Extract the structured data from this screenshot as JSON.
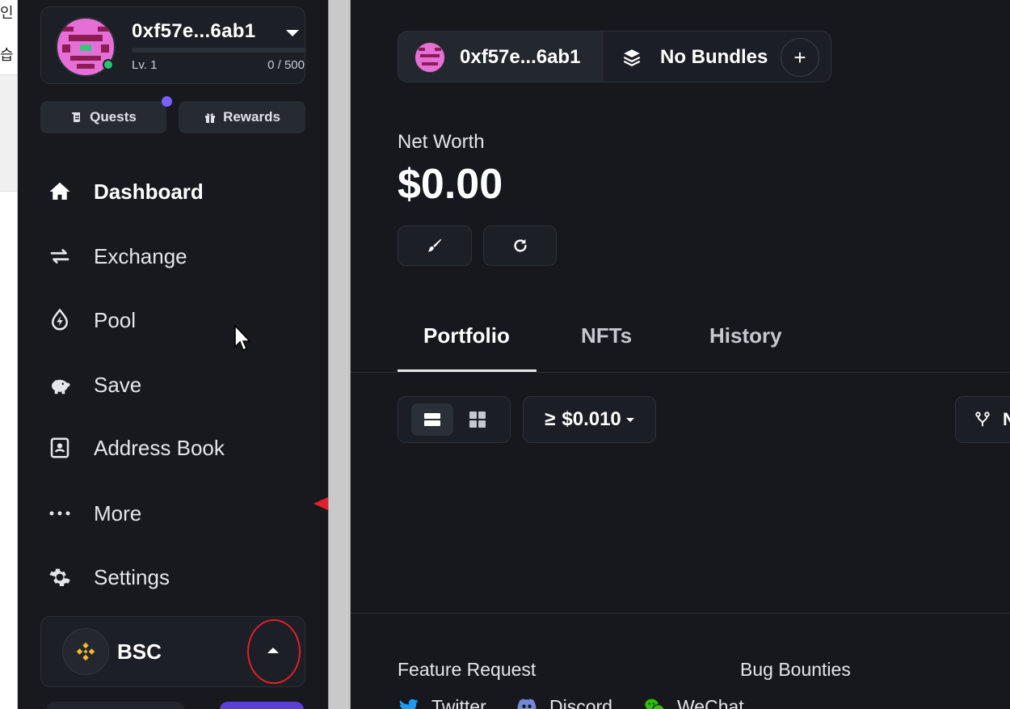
{
  "background_window": {
    "chars": [
      "인",
      "습"
    ]
  },
  "sidebar": {
    "account": {
      "name": "0xf57e...6ab1",
      "level": "Lv. 1",
      "xp": "0 / 500",
      "xp_progress": 0
    },
    "buttons": {
      "quests": "Quests",
      "rewards": "Rewards"
    },
    "nav": [
      {
        "label": "Dashboard",
        "icon": "home-icon",
        "active": true
      },
      {
        "label": "Exchange",
        "icon": "swap-arrows-icon",
        "active": false
      },
      {
        "label": "Pool",
        "icon": "lightning-drop-icon",
        "active": false
      },
      {
        "label": "Save",
        "icon": "piggy-bank-icon",
        "active": false
      },
      {
        "label": "Address Book",
        "icon": "contact-book-icon",
        "active": false
      },
      {
        "label": "More",
        "icon": "more-dots-icon",
        "active": false
      },
      {
        "label": "Settings",
        "icon": "gear-icon",
        "active": false
      }
    ],
    "chain": {
      "name": "BSC",
      "icon": "binance-icon"
    }
  },
  "main": {
    "account_bar": {
      "address": "0xf57e...6ab1",
      "bundles": "No Bundles",
      "add": "+"
    },
    "net_worth": {
      "label": "Net Worth",
      "value": "$0.00"
    },
    "tabs": [
      "Portfolio",
      "NFTs",
      "History"
    ],
    "filter": {
      "symbol": "≥",
      "value": "$0.010"
    },
    "far_button_text": "N",
    "footer": {
      "headings": [
        "Feature Request",
        "Bug Bounties"
      ],
      "social": [
        "Twitter",
        "Discord",
        "WeChat"
      ]
    }
  },
  "colors": {
    "accent": "#7b61ff",
    "online": "#27c46b",
    "binance": "#f3ba2f",
    "annotation": "#e0202a"
  }
}
